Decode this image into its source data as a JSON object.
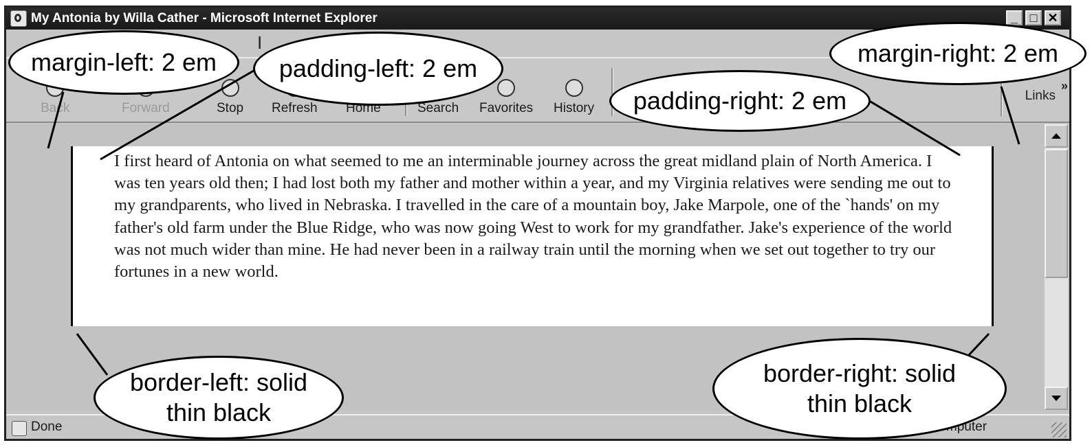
{
  "window": {
    "title": "My Antonia by Willa Cather - Microsoft Internet Explorer",
    "menu_fragment": "I"
  },
  "toolbar": {
    "buttons": [
      {
        "label": "Back",
        "icon": "back-arrow-icon",
        "enabled": false
      },
      {
        "label": "Forward",
        "icon": "forward-arrow-icon",
        "enabled": false
      },
      {
        "label": "Stop",
        "icon": "stop-icon",
        "enabled": true
      },
      {
        "label": "Refresh",
        "icon": "refresh-icon",
        "enabled": true
      },
      {
        "label": "Home",
        "icon": "home-icon",
        "enabled": true
      },
      {
        "label": "Search",
        "icon": "search-icon",
        "enabled": true
      },
      {
        "label": "Favorites",
        "icon": "favorites-icon",
        "enabled": true
      },
      {
        "label": "History",
        "icon": "history-icon",
        "enabled": true
      }
    ],
    "links_label": "Links",
    "links_chevron": "»"
  },
  "content": {
    "paragraph": "I first heard of Antonia on what seemed to me an interminable journey across the great midland plain of North America. I was ten years old then; I had lost both my father and mother within a year, and my Virginia relatives were sending me out to my grandparents, who lived in Nebraska. I travelled in the care of a mountain boy, Jake Marpole, one of the `hands' on my father's old farm under the Blue Ridge, who was now going West to work for my grandfather. Jake's experience of the world was not much wider than mine. He had never been in a railway train until the morning when we set out together to try our fortunes in a new world."
  },
  "statusbar": {
    "status": "Done",
    "zone": "My Computer"
  },
  "callouts": {
    "margin_left": "margin-left: 2 em",
    "padding_left": "padding-left: 2 em",
    "padding_right": "padding-right: 2 em",
    "margin_right": "margin-right: 2 em",
    "border_left": "border-left: solid\nthin black",
    "border_right": "border-right: solid\nthin black"
  },
  "colors": {
    "chrome": "#c6c6c6",
    "titlebar": "#1f1f1f",
    "page_background": "#ffffff",
    "border": "#000000"
  }
}
